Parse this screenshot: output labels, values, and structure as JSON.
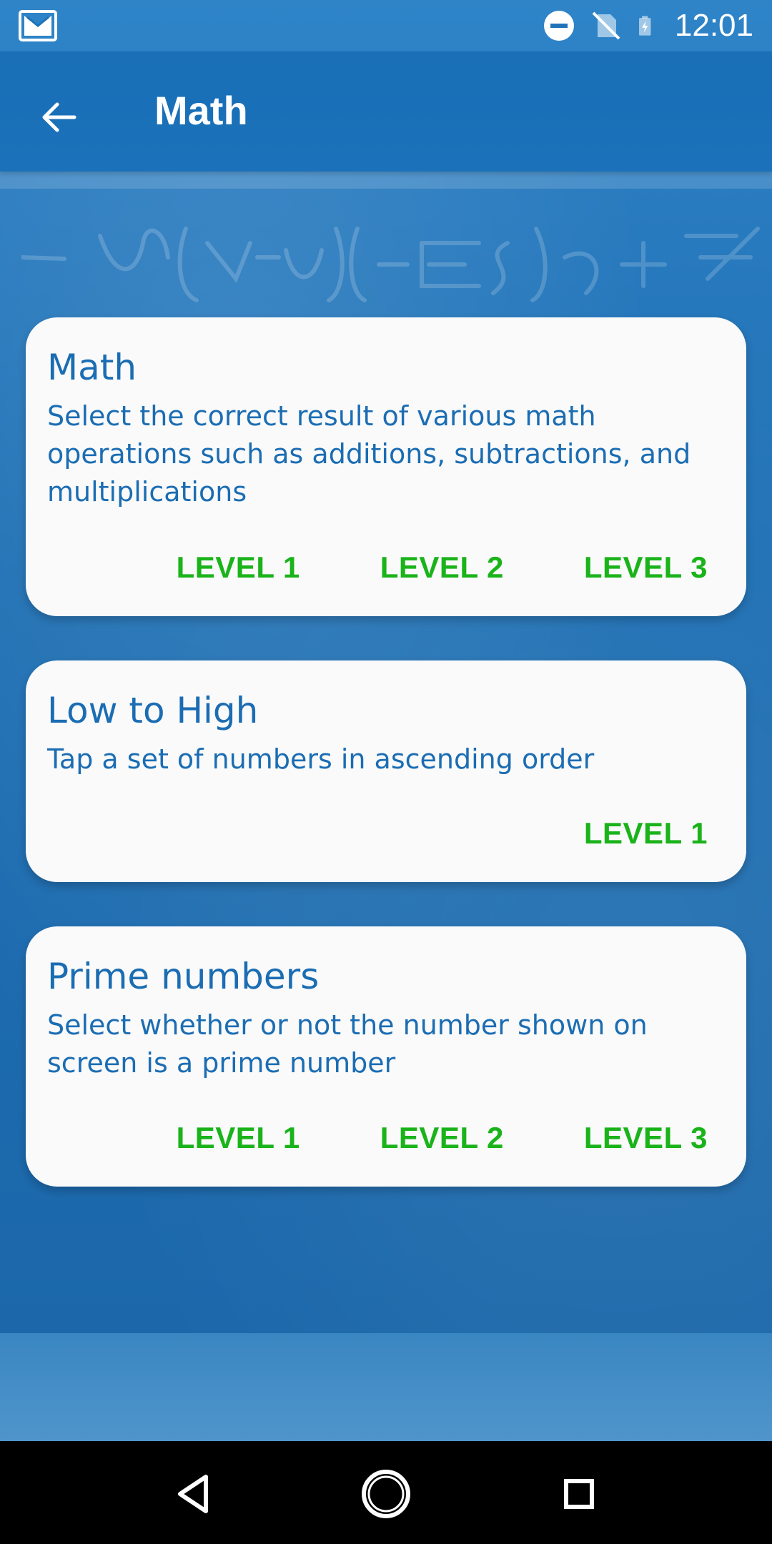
{
  "status_bar": {
    "time": "12:01",
    "icons": [
      "gmail-icon",
      "do-not-disturb-icon",
      "no-sim-icon",
      "battery-charging-icon"
    ]
  },
  "app_bar": {
    "title": "Math",
    "back_icon": "arrow-back-icon"
  },
  "cards": [
    {
      "title": "Math",
      "description": "Select the correct result of various math operations such as additions, subtractions, and multiplications",
      "levels": [
        "LEVEL 1",
        "LEVEL 2",
        "LEVEL 3"
      ]
    },
    {
      "title": "Low to High",
      "description": "Tap a set of numbers in ascending order",
      "levels": [
        "LEVEL 1"
      ]
    },
    {
      "title": "Prime numbers",
      "description": "Select whether or not the number shown on screen is a prime number",
      "levels": [
        "LEVEL 1",
        "LEVEL 2",
        "LEVEL 3"
      ]
    }
  ],
  "nav_bar": {
    "icons": [
      "back-triangle-icon",
      "home-circle-icon",
      "recents-square-icon"
    ]
  },
  "colors": {
    "accent": "#1b72ba",
    "card_text": "#1b6db3",
    "level_green": "#1ab31a",
    "card_bg": "#fafafa"
  }
}
